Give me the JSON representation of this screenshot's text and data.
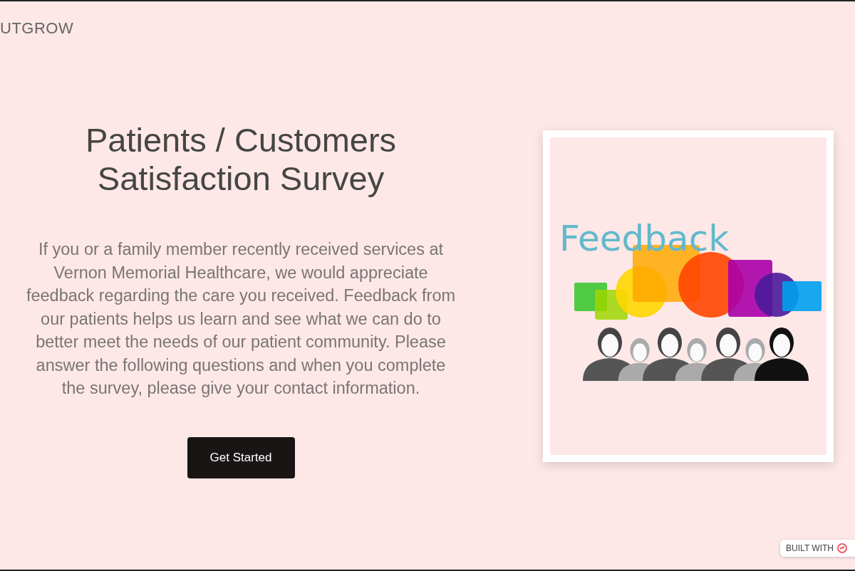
{
  "header": {
    "logo": "UTGROW"
  },
  "intro": {
    "title_lines": [
      "Patients / Customers",
      "Satisfaction Survey"
    ],
    "description": "If you or a family member recently received services at Vernon Memorial Healthcare, we would appreciate feedback regarding the care you received. Feedback from our patients helps us learn and see what we can do to better meet the needs of our patient community. Please answer the following questions and when you complete the survey, please give your contact information.",
    "button": "Get Started"
  },
  "illustration": {
    "kind": "picture",
    "caption": "Feedback"
  },
  "badge": {
    "label": "BUILT WITH"
  }
}
